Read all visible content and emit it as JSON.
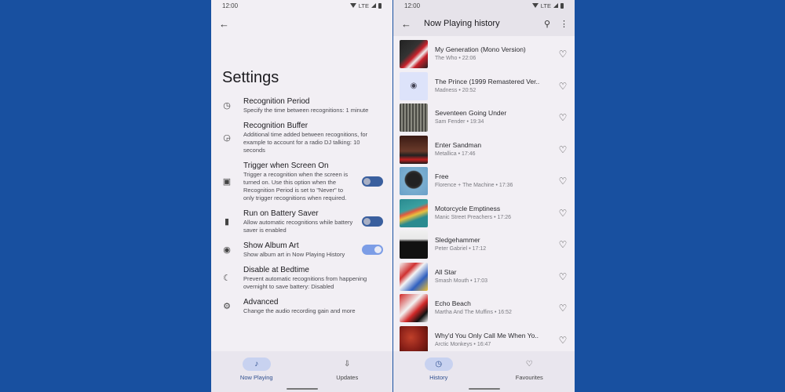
{
  "left_phone": {
    "status": {
      "time": "12:00",
      "network": "LTE"
    },
    "title": "Settings",
    "settings": [
      {
        "icon": "clock-icon",
        "glyph": "◷",
        "title": "Recognition Period",
        "desc": "Specify the time between recognitions: 1 minute",
        "toggle": null
      },
      {
        "icon": "clock-plus-icon",
        "glyph": "◶",
        "title": "Recognition Buffer",
        "desc": "Additional time added between recognitions, for example to account for a radio DJ talking: 10 seconds",
        "toggle": null
      },
      {
        "icon": "screen-icon",
        "glyph": "▣",
        "title": "Trigger when Screen On",
        "desc": "Trigger a recognition when the screen is turned on. Use this option when the Recognition Period is set to \"Never\" to only trigger recognitions when required.",
        "toggle": false
      },
      {
        "icon": "battery-icon",
        "glyph": "▮",
        "title": "Run on Battery Saver",
        "desc": "Allow automatic recognitions while battery saver is enabled",
        "toggle": false
      },
      {
        "icon": "album-icon",
        "glyph": "◉",
        "title": "Show Album Art",
        "desc": "Show album art in Now Playing History",
        "toggle": true
      },
      {
        "icon": "moon-icon",
        "glyph": "☾",
        "title": "Disable at Bedtime",
        "desc": "Prevent automatic recognitions from happening overnight to save battery: Disabled",
        "toggle": null
      },
      {
        "icon": "gear-icon",
        "glyph": "⚙",
        "title": "Advanced",
        "desc": "Change the audio recording gain and more",
        "toggle": null
      }
    ],
    "nav": [
      {
        "label": "Now Playing",
        "glyph": "♪",
        "icon": "music-note-icon",
        "active": true
      },
      {
        "label": "Updates",
        "glyph": "⇩",
        "icon": "updates-icon",
        "active": false
      }
    ]
  },
  "right_phone": {
    "status": {
      "time": "12:00",
      "network": "LTE"
    },
    "title": "Now Playing history",
    "tracks": [
      {
        "title": "My Generation (Mono Version)",
        "artist": "The Who",
        "time": "22:06",
        "art": "linear-gradient(135deg,#222 0%,#333 40%,#c8202a 55%,#eee 65%,#c8202a 75%,#222 100%)"
      },
      {
        "title": "The Prince (1999 Remastered Ver..",
        "artist": "Madness",
        "time": "20:52",
        "art": "#dde3fa"
      },
      {
        "title": "Seventeen Going Under",
        "artist": "Sam Fender",
        "time": "19:34",
        "art": "repeating-linear-gradient(90deg,#4a4a44 0 2px,#8a8a80 2px 4px)"
      },
      {
        "title": "Enter Sandman",
        "artist": "Metallica",
        "time": "17:46",
        "art": "linear-gradient(180deg,#3a1a14 0%,#6a3a2a 55%,#222 70%,#c02020 85%,#1a1a1a 100%)"
      },
      {
        "title": "Free",
        "artist": "Florence + The Machine",
        "time": "17:36",
        "art": "radial-gradient(circle at 50% 45%,#222 0 30%,#333 40%,#7aaed0 45%,#6aa0c8 100%)"
      },
      {
        "title": "Motorcycle Emptiness",
        "artist": "Manic Street Preachers",
        "time": "17:26",
        "art": "linear-gradient(160deg,#2a8a90 0%,#3aa0a0 35%,#e05a40 45%,#e8c040 55%,#2a8a90 70%)"
      },
      {
        "title": "Sledgehammer",
        "artist": "Peter Gabriel",
        "time": "17:12",
        "art": "linear-gradient(180deg,#f0f0f0 0%,#e8e8e8 30%,#111 40%,#111 100%)"
      },
      {
        "title": "All Star",
        "artist": "Smash Mouth",
        "time": "17:03",
        "art": "linear-gradient(135deg,#f4f4f4 0%,#d03030 30%,#f4f4f4 45%,#3060c0 70%,#f0c030 100%)"
      },
      {
        "title": "Echo Beach",
        "artist": "Martha And The Muffins",
        "time": "16:52",
        "art": "linear-gradient(135deg,#d02828 0%,#f2f2f2 40%,#d02828 60%,#111 80%,#f2f2f2 100%)"
      },
      {
        "title": "Why'd You Only Call Me When Yo..",
        "artist": "Arctic Monkeys",
        "time": "16:47",
        "art": "radial-gradient(circle at 40% 40%,#c0402a 0%,#8a2018 50%,#4a1008 100%)"
      }
    ],
    "nav": [
      {
        "label": "History",
        "glyph": "◷",
        "icon": "history-icon",
        "active": true
      },
      {
        "label": "Favourites",
        "glyph": "♡",
        "icon": "heart-outline-icon",
        "active": false
      }
    ]
  }
}
